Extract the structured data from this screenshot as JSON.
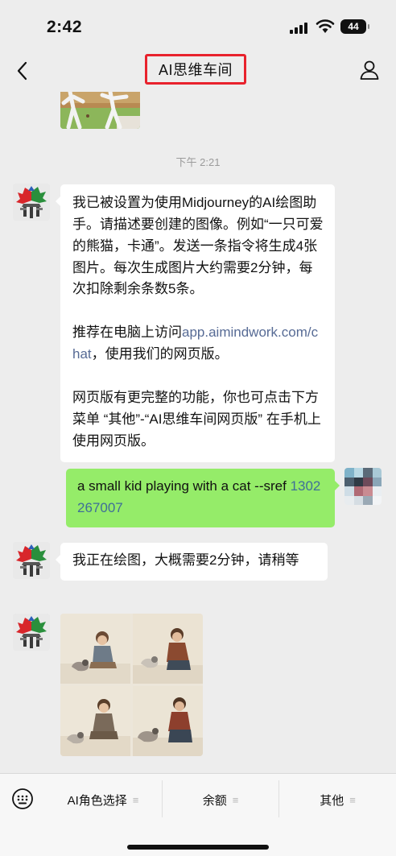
{
  "status_bar": {
    "time": "2:42",
    "battery": "44"
  },
  "nav": {
    "title": "AI思维车间"
  },
  "chat": {
    "timestamp": "下午 2:21",
    "messages": [
      {
        "from": "bot",
        "paragraphs": [
          "我已被设置为使用Midjourney的AI绘图助手。请描述要创建的图像。例如“一只可爱的熊猫，卡通”。发送一条指令将生成4张图片。每次生成图片大约需要2分钟，每次扣除剩余条数5条。",
          {
            "before": "推荐在电脑上访问",
            "link": "app.aimindwork.com/chat",
            "after": "，使用我们的网页版。"
          },
          "网页版有更完整的功能，你也可点击下方菜单 “其他”-“AI思维车间网页版” 在手机上使用网页版。"
        ]
      },
      {
        "from": "user",
        "text": "a small kid playing with a cat --sref",
        "sref": "1302267007"
      },
      {
        "from": "bot",
        "text": "我正在绘图，大概需要2分钟，请稍等"
      },
      {
        "from": "bot",
        "type": "image-grid"
      }
    ]
  },
  "menu": {
    "items": [
      {
        "label": "AI角色选择"
      },
      {
        "label": "余额"
      },
      {
        "label": "其他"
      }
    ],
    "lines_glyph": "≡"
  },
  "colors": {
    "accent_red": "#e8222d",
    "bubble_green": "#95ec69",
    "link": "#576b95"
  }
}
